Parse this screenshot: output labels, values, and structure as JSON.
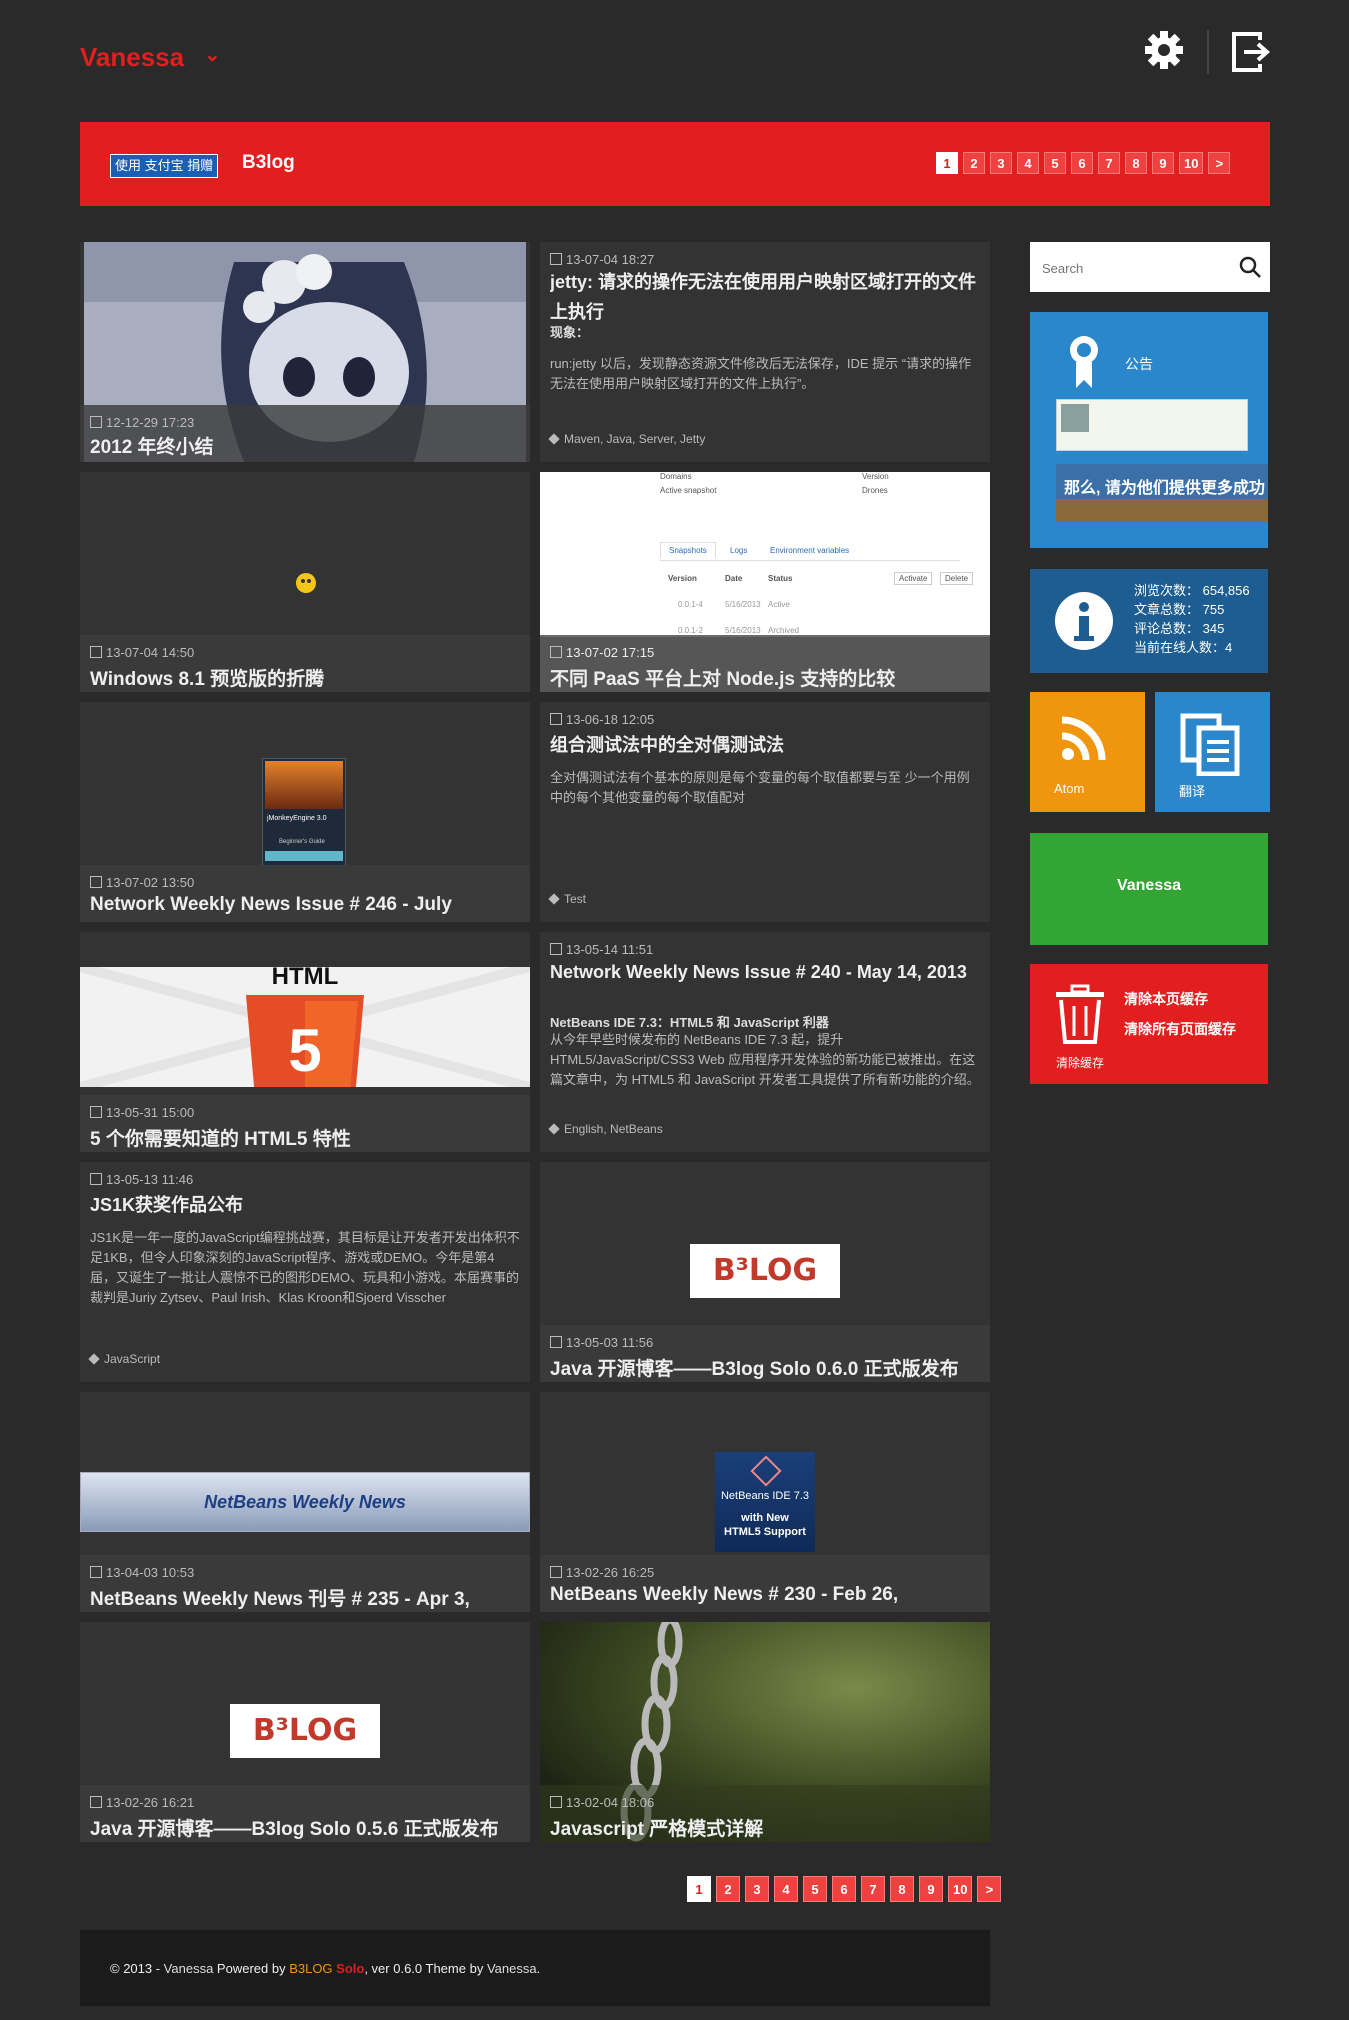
{
  "header": {
    "brand": "Vanessa",
    "chevron": "⌄",
    "settings_icon": "gear-icon",
    "logout_icon": "logout-icon"
  },
  "banner": {
    "alipay_text": "使用 支付宝 捐赠",
    "title": "B3log"
  },
  "pagination": {
    "pages": [
      "1",
      "2",
      "3",
      "4",
      "5",
      "6",
      "7",
      "8",
      "9",
      "10"
    ],
    "current": "1",
    "next": ">"
  },
  "articles": [
    {
      "date": "12-12-29 17:23",
      "title": "2012 年终小结"
    },
    {
      "date": "13-07-04 18:27",
      "title": "jetty: 请求的操作无法在使用用户映射区域打开的文件上执行",
      "subtitle": "现象：",
      "excerpt": "run:jetty 以后，发现静态资源文件修改后无法保存，IDE 提示 “请求的操作无法在使用用户映射区域打开的文件上执行”。",
      "tags": "Maven, Java, Server, Jetty"
    },
    {
      "date": "13-07-04 14:50",
      "title": "Windows 8.1 预览版的折腾"
    },
    {
      "date": "13-07-02 17:15",
      "title": "不同 PaaS 平台上对 Node.js 支持的比较"
    },
    {
      "date": "13-07-02 13:50",
      "title": "Network Weekly News Issue # 246 - July"
    },
    {
      "date": "13-06-18 12:05",
      "title": "组合测试法中的全对偶测试法",
      "excerpt": "全对偶测试法有个基本的原则是每个变量的每个取值都要与至 少一个用例中的每个其他变量的每个取值配对",
      "tags": "Test"
    },
    {
      "date": "13-05-31 15:00",
      "title": "5 个你需要知道的 HTML5 特性"
    },
    {
      "date": "13-05-14 11:51",
      "title": "Network Weekly News Issue # 240 - May 14, 2013",
      "subtitle": "NetBeans IDE 7.3：HTML5 和 JavaScript 利器",
      "excerpt": "从今年早些时候发布的 NetBeans IDE 7.3 起，提升 HTML5/JavaScript/CSS3 Web 应用程序开发体验的新功能已被推出。在这篇文章中，为 HTML5 和 JavaScript 开发者工具提供了所有新功能的介绍。",
      "tags": "English, NetBeans"
    },
    {
      "date": "13-05-13 11:46",
      "title": "JS1K获奖作品公布",
      "excerpt": "JS1K是一年一度的JavaScript编程挑战赛，其目标是让开发者开发出体积不足1KB，但令人印象深刻的JavaScript程序、游戏或DEMO。今年是第4届，又诞生了一批让人震惊不已的图形DEMO、玩具和小游戏。本届赛事的裁判是Juriy Zytsev、Paul Irish、Klas Kroon和Sjoerd Visscher",
      "tags": "JavaScript"
    },
    {
      "date": "13-05-03 11:56",
      "title": "Java 开源博客——B3log Solo 0.6.0 正式版发布"
    },
    {
      "date": "13-04-03 10:53",
      "title": "NetBeans Weekly News 刊号 # 235 - Apr 3,"
    },
    {
      "date": "13-02-26 16:25",
      "title": "NetBeans Weekly News # 230 - Feb 26,"
    },
    {
      "date": "13-02-26 16:21",
      "title": "Java 开源博客——B3log Solo 0.5.6 正式版发布"
    },
    {
      "date": "13-02-04 18:06",
      "title": "Javascript 严格模式详解"
    }
  ],
  "thumbs": {
    "b3log_logo": "B³LOG",
    "html5_label": "HTML",
    "html5_digit": "5",
    "netbeans_banner": "NetBeans Weekly News",
    "netbeans_ide_l1": "NetBeans IDE 7.3",
    "netbeans_ide_l2": "with New",
    "netbeans_ide_l3": "HTML5 Support",
    "book_title": "jMonkeyEngine 3.0",
    "book_sub": "Beginner's Guide",
    "paas_labels": {
      "domains": "Domains",
      "active_snapshot": "Active snapshot",
      "version_h": "Version",
      "drones": "Drones",
      "tab_snapshots": "Snapshots",
      "tab_logs": "Logs",
      "tab_env": "Environment variables",
      "col_version": "Version",
      "col_date": "Date",
      "col_status": "Status",
      "btn_activate": "Activate",
      "btn_delete": "Delete",
      "row1_version": "0.0.1-4",
      "row1_date": "5/16/2013",
      "row1_status": "Active",
      "row2_version": "0.0.1-2",
      "row2_date": "5/16/2013",
      "row2_status": "Archived"
    }
  },
  "sidebar": {
    "search_placeholder": "Search",
    "announce_label": "公告",
    "announce_banner": "那么, 请为他们提供更多成功",
    "stats": {
      "views": "浏览次数： 654,856",
      "articles": "文章总数： 755",
      "comments": "评论总数： 345",
      "online": "当前在线人数：4"
    },
    "atom_label": "Atom",
    "translate_label": "翻译",
    "user_label": "Vanessa",
    "clear_page_cache": "清除本页缓存",
    "clear_all_cache": "清除所有页面缓存",
    "clear_cache_label": "清除缓存"
  },
  "footer": {
    "prefix": "© 2013 - ",
    "author": "Vanessa",
    "powered_by": " Powered by ",
    "b3log": "B3LOG",
    "solo": " Solo",
    "version": ", ver 0.6.0  Theme by ",
    "theme_author": "Vanessa",
    "end": "."
  },
  "colors": {
    "accent": "#e21e1e",
    "bg": "#2a2a2a",
    "card": "#333333",
    "atom": "#f0960e",
    "blue": "#2b87cc",
    "green": "#33a532"
  }
}
